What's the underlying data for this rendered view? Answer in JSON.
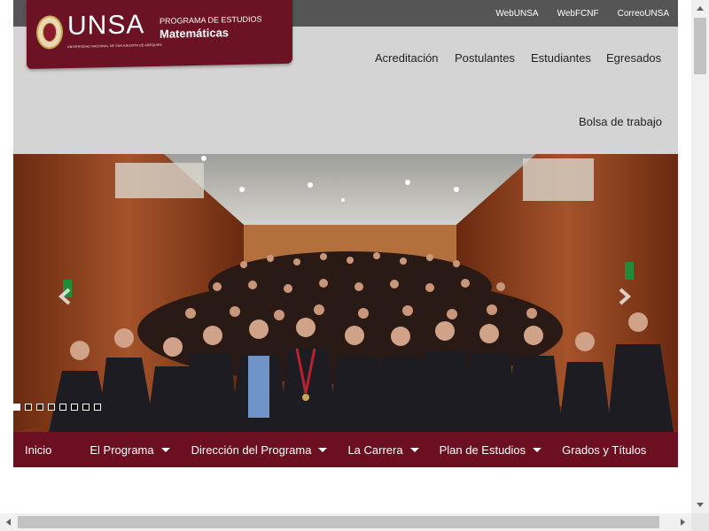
{
  "toplinks": [
    "WebUNSA",
    "WebFCNF",
    "CorreoUNSA"
  ],
  "logo": {
    "wordmark": "UNSA",
    "subtitle": "UNIVERSIDAD NACIONAL DE SAN AGUSTÍN DE AREQUIPA",
    "program_label": "PROGRAMA DE ESTUDIOS",
    "program_name": "Matemáticas"
  },
  "nav": {
    "items": [
      "Acreditación",
      "Postulantes",
      "Estudiantes",
      "Egresados",
      "Bolsa de trabajo"
    ]
  },
  "hero": {
    "slide_count": 8,
    "active_slide": 1,
    "prev_icon": "chevron-left-icon",
    "next_icon": "chevron-right-icon"
  },
  "menu": {
    "items": [
      {
        "label": "Inicio",
        "dropdown": false
      },
      {
        "label": "El Programa",
        "dropdown": true
      },
      {
        "label": "Dirección del Programa",
        "dropdown": true
      },
      {
        "label": "La Carrera",
        "dropdown": true
      },
      {
        "label": "Plan de Estudios",
        "dropdown": true
      },
      {
        "label": "Grados y Títulos",
        "dropdown": false
      }
    ]
  },
  "colors": {
    "brand": "#6b1324",
    "menubar": "#6b0f21",
    "topbar": "#555555",
    "header_bg": "#d4d4d4"
  }
}
